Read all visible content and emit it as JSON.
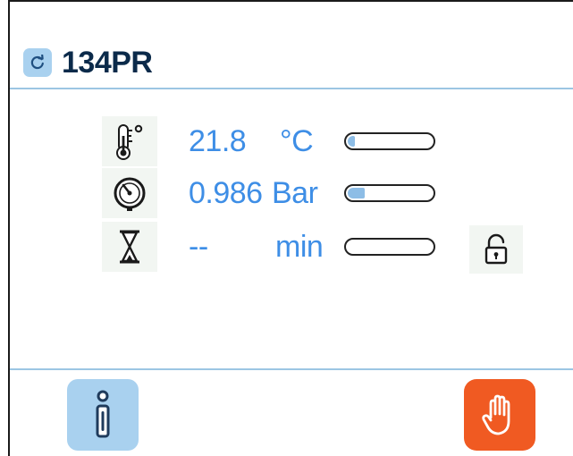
{
  "header": {
    "title": "134PR",
    "refresh_icon": "refresh-icon"
  },
  "readings": [
    {
      "name": "temperature",
      "icon": "thermometer-icon",
      "value": "21.8",
      "unit": "°C",
      "level": 0.08
    },
    {
      "name": "pressure",
      "icon": "pressure-gauge-icon",
      "value": "0.986",
      "unit": "Bar",
      "level": 0.2
    },
    {
      "name": "time",
      "icon": "hourglass-icon",
      "value": "--",
      "unit": "min",
      "level": 0.0
    }
  ],
  "icons": {
    "lock": "unlock-icon",
    "info": "info-icon",
    "stop": "stop-hand-icon"
  },
  "colors": {
    "accent_blue": "#3e8ee6",
    "button_blue": "#a9d1ef",
    "divider": "#9cc6e3",
    "stop_orange": "#f05a22"
  }
}
